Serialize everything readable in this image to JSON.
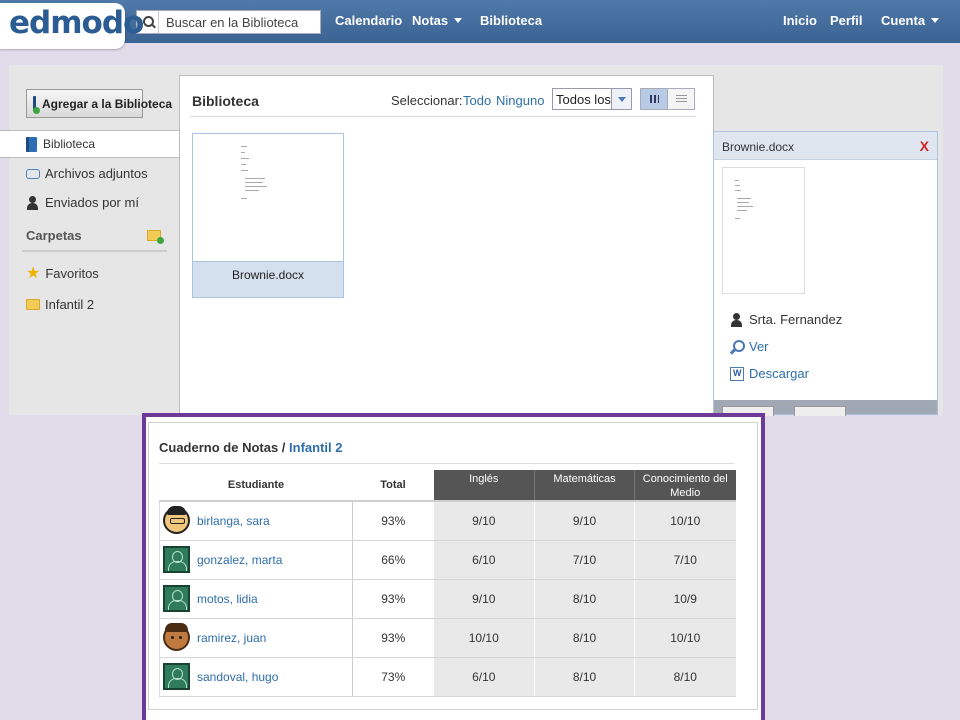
{
  "header": {
    "logo": "edmodo",
    "search_placeholder": "Buscar en la Biblioteca",
    "nav": {
      "calendario": "Calendario",
      "notas": "Notas",
      "biblioteca": "Biblioteca"
    },
    "right": {
      "inicio": "Inicio",
      "perfil": "Perfil",
      "cuenta": "Cuenta"
    }
  },
  "sidebar": {
    "add_button": "Agregar a la Biblioteca",
    "items": [
      {
        "label": "Biblioteca"
      },
      {
        "label": "Archivos adjuntos"
      },
      {
        "label": "Enviados por mí"
      }
    ],
    "folders_heading": "Carpetas",
    "folders": [
      {
        "label": "Favoritos"
      },
      {
        "label": "Infantil 2"
      }
    ]
  },
  "library": {
    "title": "Biblioteca",
    "select_label": "Seleccionar:",
    "select_all": "Todo",
    "select_none": "Ninguno",
    "filter_value": "Todos los",
    "files": [
      {
        "name": "Brownie.docx"
      }
    ]
  },
  "detail": {
    "title": "Brownie.docx",
    "close": "X",
    "owner": "Srta. Fernandez",
    "view": "Ver",
    "download": "Descargar"
  },
  "gradebook": {
    "title": "Cuaderno de Notas /",
    "class_name": "Infantil 2",
    "columns": {
      "student": "Estudiante",
      "total": "Total",
      "subjects": [
        "Inglés",
        "Matemáticas",
        "Conocimiento del Medio"
      ]
    },
    "rows": [
      {
        "name": "birlanga, sara",
        "total": "93%",
        "grades": [
          "9/10",
          "9/10",
          "10/10"
        ],
        "avatar": "girl-avatar"
      },
      {
        "name": "gonzalez, marta",
        "total": "66%",
        "grades": [
          "6/10",
          "7/10",
          "7/10"
        ],
        "avatar": "default-avatar"
      },
      {
        "name": "motos, lidia",
        "total": "93%",
        "grades": [
          "9/10",
          "8/10",
          "10/9"
        ],
        "avatar": "default-avatar"
      },
      {
        "name": "ramirez, juan",
        "total": "93%",
        "grades": [
          "10/10",
          "8/10",
          "10/10"
        ],
        "avatar": "boy-avatar"
      },
      {
        "name": "sandoval, hugo",
        "total": "73%",
        "grades": [
          "6/10",
          "8/10",
          "8/10"
        ],
        "avatar": "default-avatar"
      }
    ]
  },
  "colors": {
    "nav_blue": "#3b6393",
    "link_blue": "#2e6eab",
    "frame_purple": "#6d3a9a",
    "close_red": "#d42222"
  }
}
